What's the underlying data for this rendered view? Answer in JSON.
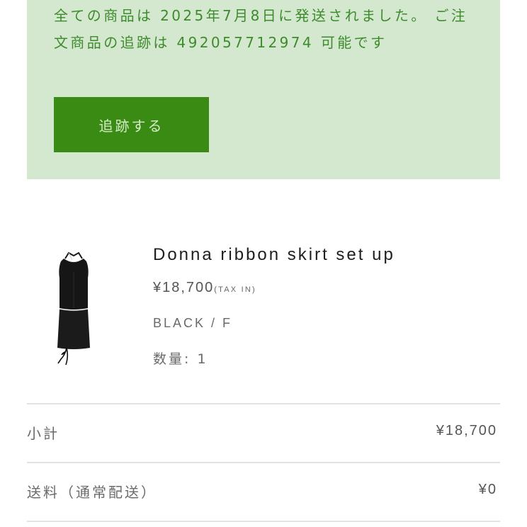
{
  "notice": {
    "message": "全ての商品は 2025年7月8日に発送されました。 ご注文商品の追跡は 492057712974 可能です",
    "track_button_label": "追跡する"
  },
  "item": {
    "name": "Donna ribbon skirt set up",
    "price": "¥18,700",
    "tax_note": "(TAX IN)",
    "variant": "BLACK / F",
    "quantity": "数量: 1"
  },
  "summary": {
    "subtotal_label": "小計",
    "subtotal_value": "¥18,700",
    "shipping_label": "送料（通常配送）",
    "shipping_value": "¥0"
  }
}
